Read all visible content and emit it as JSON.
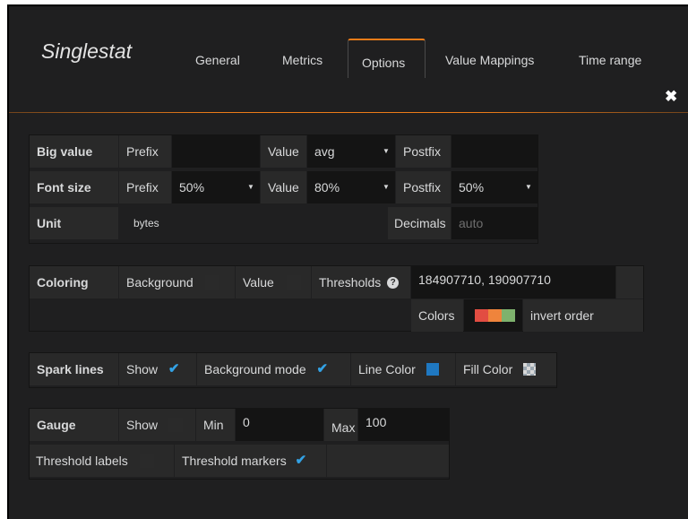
{
  "editor": {
    "title": "Singlestat"
  },
  "tabs": [
    {
      "label": "General"
    },
    {
      "label": "Metrics"
    },
    {
      "label": "Options"
    },
    {
      "label": "Value Mappings"
    },
    {
      "label": "Time range"
    }
  ],
  "colors": {
    "accent": "#eb7b18",
    "check": "#33a2e5",
    "threshold_colors": [
      "#e24d42",
      "#ef843c",
      "#7eb26d"
    ],
    "line_color": "#1f78c1"
  },
  "big_value": {
    "label": "Big value",
    "prefix_label": "Prefix",
    "prefix_value": "",
    "value_label": "Value",
    "value_select": "avg",
    "postfix_label": "Postfix",
    "postfix_value": ""
  },
  "font_size": {
    "label": "Font size",
    "prefix_label": "Prefix",
    "prefix_select": "50%",
    "value_label": "Value",
    "value_select": "80%",
    "postfix_label": "Postfix",
    "postfix_select": "50%"
  },
  "unit": {
    "label": "Unit",
    "value": "bytes",
    "decimals_label": "Decimals",
    "decimals_placeholder": "auto"
  },
  "coloring": {
    "label": "Coloring",
    "background_label": "Background",
    "value_label": "Value",
    "thresholds_label": "Thresholds",
    "thresholds_value": "184907710, 190907710",
    "colors_label": "Colors",
    "invert_label": "invert order"
  },
  "spark": {
    "label": "Spark lines",
    "show_label": "Show",
    "background_mode_label": "Background mode",
    "line_color_label": "Line Color",
    "fill_color_label": "Fill Color"
  },
  "gauge": {
    "label": "Gauge",
    "show_label": "Show",
    "min_label": "Min",
    "min_value": "0",
    "max_label": "Max",
    "max_value": "100",
    "threshold_labels_label": "Threshold labels",
    "threshold_markers_label": "Threshold markers"
  }
}
